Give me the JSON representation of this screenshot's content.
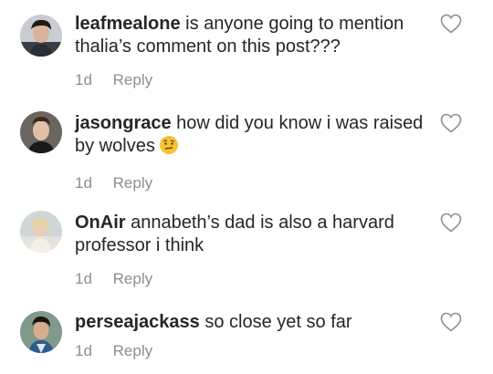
{
  "comments": [
    {
      "username": "leafmealone",
      "text": "is anyone going to mention thalia’s comment on this post???",
      "age": "1d",
      "reply_label": "Reply",
      "avatar": "young-man-dark-hair-avatar"
    },
    {
      "username": "jasongrace",
      "text": "how did you know i was raised by wolves",
      "emoji": "face-with-raised-eyebrow-emoji",
      "age": "1d",
      "reply_label": "Reply",
      "avatar": "young-man-portrait-avatar"
    },
    {
      "username": "OnAir",
      "text": "annabeth’s dad is also a harvard professor i think",
      "age": "1d",
      "reply_label": "Reply",
      "avatar": "blonde-woman-outdoor-avatar"
    },
    {
      "username": "perseajackass",
      "text": "so close yet so far",
      "age": "1d",
      "reply_label": "Reply",
      "avatar": "young-man-outdoor-avatar"
    }
  ],
  "colors": {
    "text": "#262626",
    "secondary": "#8e8e8e",
    "heart_outline": "#8e8e8e",
    "emoji_yellow": "#f7c234"
  }
}
